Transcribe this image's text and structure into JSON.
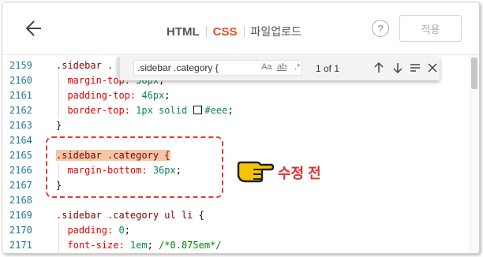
{
  "header": {
    "tabs": [
      {
        "label": "HTML"
      },
      {
        "label": "CSS"
      },
      {
        "label": "파일업로드"
      }
    ],
    "help_label": "?",
    "apply_label": "적용"
  },
  "find": {
    "query": ".sidebar .category {",
    "opt_case": "Aa",
    "opt_word": "ab",
    "opt_regex": ".*",
    "count": "1 of 1"
  },
  "callout": {
    "text": "수정 전"
  },
  "code": {
    "lines": [
      {
        "n": "2159",
        "p": [
          {
            "t": ".sidebar .",
            "c": "sel"
          }
        ]
      },
      {
        "n": "2160",
        "p": [
          {
            "t": "  margin-top: ",
            "c": "prop"
          },
          {
            "t": "36px",
            "c": "val"
          },
          {
            "t": ";",
            "c": "punct"
          }
        ]
      },
      {
        "n": "2161",
        "p": [
          {
            "t": "  padding-top: ",
            "c": "prop"
          },
          {
            "t": "46px",
            "c": "val"
          },
          {
            "t": ";",
            "c": "punct"
          }
        ]
      },
      {
        "n": "2162",
        "p": [
          {
            "t": "  border-top: ",
            "c": "prop"
          },
          {
            "t": "1px solid ",
            "c": "val"
          },
          {
            "t": "",
            "c": "colorbox"
          },
          {
            "t": "#eee",
            "c": "val"
          },
          {
            "t": ";",
            "c": "punct"
          }
        ]
      },
      {
        "n": "2163",
        "p": [
          {
            "t": "}",
            "c": "punct"
          }
        ]
      },
      {
        "n": "2164",
        "p": []
      },
      {
        "n": "2165",
        "p": [
          {
            "t": ".sidebar .category {",
            "c": "sel hl"
          }
        ]
      },
      {
        "n": "2166",
        "p": [
          {
            "t": "  margin-bottom: ",
            "c": "prop"
          },
          {
            "t": "36px",
            "c": "val"
          },
          {
            "t": ";",
            "c": "punct"
          }
        ]
      },
      {
        "n": "2167",
        "p": [
          {
            "t": "}",
            "c": "punct"
          }
        ]
      },
      {
        "n": "2168",
        "p": []
      },
      {
        "n": "2169",
        "p": [
          {
            "t": ".sidebar .category ul li ",
            "c": "sel"
          },
          {
            "t": "{",
            "c": "punct"
          }
        ]
      },
      {
        "n": "2170",
        "p": [
          {
            "t": "  padding: ",
            "c": "prop"
          },
          {
            "t": "0",
            "c": "val"
          },
          {
            "t": ";",
            "c": "punct"
          }
        ]
      },
      {
        "n": "2171",
        "p": [
          {
            "t": "  font-size: ",
            "c": "prop"
          },
          {
            "t": "1em",
            "c": "val"
          },
          {
            "t": "; ",
            "c": "punct"
          },
          {
            "t": "/*0.875em*/",
            "c": "cmt"
          }
        ]
      }
    ]
  },
  "colors": {
    "accent": "#e5501f",
    "annotation": "#e53935",
    "pointer": "#f5c400"
  }
}
